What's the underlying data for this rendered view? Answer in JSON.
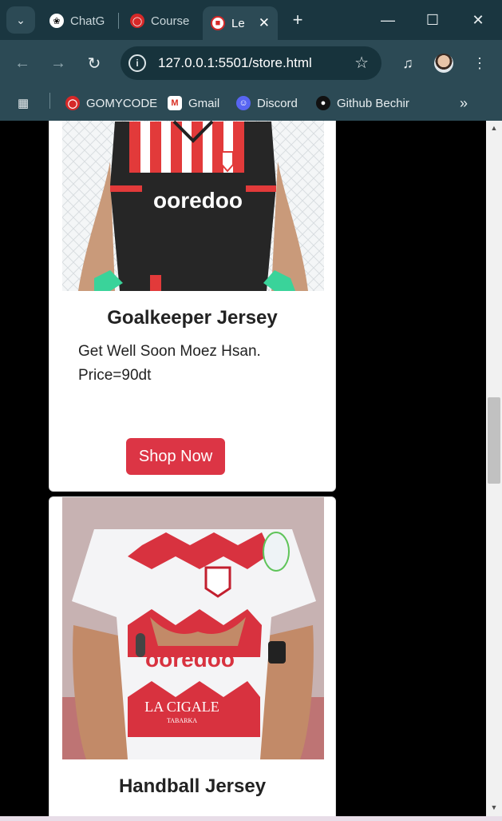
{
  "browser": {
    "tabs": [
      {
        "label": "ChatG",
        "icon": "chatgpt-icon"
      },
      {
        "label": "Course",
        "icon": "gomycode-icon"
      },
      {
        "label": "Le",
        "icon": "club-crest-icon",
        "active": true
      }
    ],
    "url": "127.0.0.1:5501/store.html",
    "bookmarks": [
      {
        "label": "GOMYCODE",
        "icon": "gomycode-icon"
      },
      {
        "label": "Gmail",
        "icon": "gmail-icon"
      },
      {
        "label": "Discord",
        "icon": "discord-icon"
      },
      {
        "label": "Github Bechir",
        "icon": "github-icon"
      }
    ]
  },
  "products": [
    {
      "title": "Goalkeeper Jersey",
      "description": "Get Well Soon Moez Hsan.",
      "price": "Price=90dt",
      "button": "Shop Now",
      "sponsor_text": "ooredoo"
    },
    {
      "title": "Handball Jersey",
      "sponsor_text": "ooredoo",
      "shirt_text": "LA CIGALE",
      "shirt_subtext": "TABARKA"
    }
  ],
  "colors": {
    "accent": "#dc3545",
    "browser_frame": "#2c4a55",
    "page_background": "#000000"
  }
}
